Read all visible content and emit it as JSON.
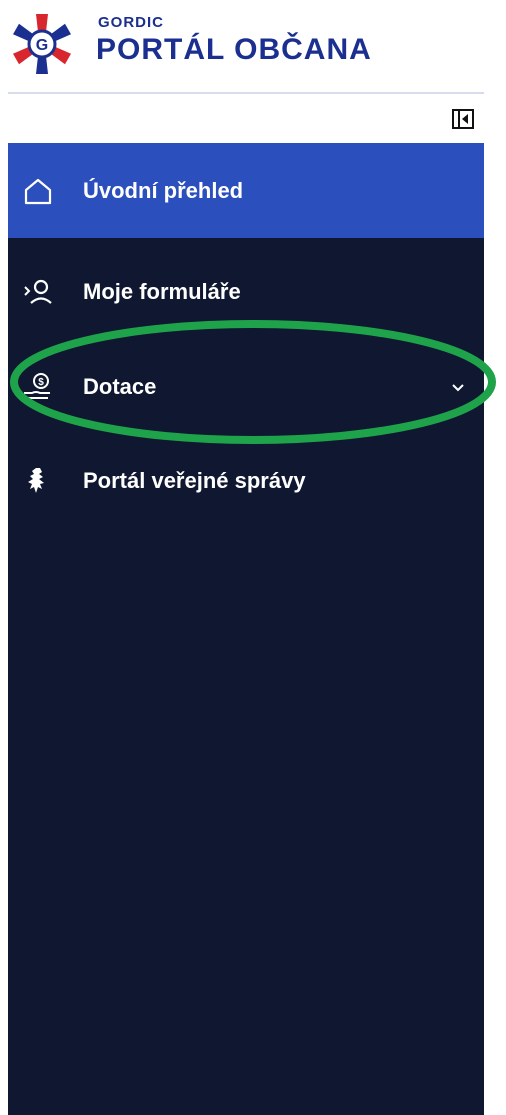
{
  "header": {
    "brand_small": "GORDIC",
    "brand_big": "PORTÁL OBČANA",
    "logo_letter": "G"
  },
  "sidebar": {
    "items": [
      {
        "label": "Úvodní přehled",
        "icon": "home-icon",
        "active": true
      },
      {
        "label": "Moje formuláře",
        "icon": "forms-user-icon",
        "active": false
      },
      {
        "label": "Dotace",
        "icon": "subsidy-hand-coin-icon",
        "active": false,
        "has_submenu": true
      },
      {
        "label": "Portál veřejné správy",
        "icon": "czech-lion-icon",
        "active": false
      }
    ]
  },
  "colors": {
    "brand_blue": "#1a2f8f",
    "sidebar_bg": "#0f1830",
    "active_bg": "#2b4fbd",
    "highlight_green": "#1fa34a",
    "logo_red": "#d8262e"
  }
}
